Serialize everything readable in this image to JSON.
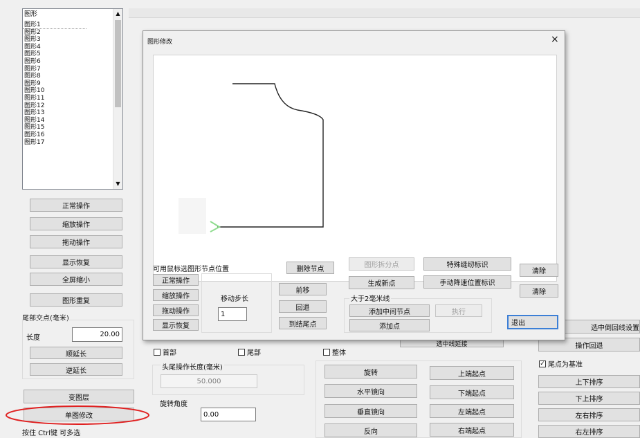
{
  "list": {
    "header": "图形",
    "items": [
      "图形1",
      "图形2",
      "图形3",
      "图形4",
      "图形5",
      "图形6",
      "图形7",
      "图形8",
      "图形9",
      "图形10",
      "图形11",
      "图形12",
      "图形13",
      "图形14",
      "图形15",
      "图形16",
      "图形17"
    ]
  },
  "left_buttons": [
    "正常操作",
    "缩放操作",
    "拖动操作",
    "显示恢复",
    "全屏缩小",
    "图形重复"
  ],
  "tail": {
    "label": "尾部交点(毫米)",
    "length_label": "长度",
    "length_value": "20.00",
    "extend": "顺延长",
    "reverse": "逆延长"
  },
  "layer_btn": "变图层",
  "single_edit": "单图修改",
  "hint": "按住 Ctrl键 可多选",
  "dialog": {
    "title": "图形修改",
    "close": "×",
    "node_label": "可用鼠标选图形节点位置",
    "ops": [
      "正常操作",
      "缩放操作",
      "拖动操作",
      "显示恢复"
    ],
    "step_label": "移动步长",
    "step_value": "1",
    "del_node": "删除节点",
    "forward": "前移",
    "back": "回退",
    "to_end": "到结尾点",
    "split": "图形拆分点",
    "new_point": "生成新点",
    "gt2": "大于2毫米线",
    "add_mid": "添加中间节点",
    "add_point": "添加点",
    "exec": "执行",
    "special": "特殊缝纫标识",
    "manual": "手动降速位置标识",
    "clear1": "清除",
    "clear2": "清除",
    "exit": "退出"
  },
  "bottom": {
    "head_cb": "首部",
    "tail_cb": "尾部",
    "whole_cb": "整体",
    "head_len_label": "头尾操作长度(毫米)",
    "head_len_value": "50.000",
    "angle_label": "旋转角度",
    "angle_value": "0.00",
    "rotate": "旋转",
    "h_mirror": "水平镜向",
    "v_mirror": "垂直镜向",
    "reverse": "反向",
    "up_start": "上端起点",
    "down_start": "下端起点",
    "left_start": "左端起点",
    "right_start": "右端起点",
    "hidden_btn": "选中线延接",
    "tail_base": "尾点为基准",
    "tail_base_mark": "✓",
    "sort": [
      "上下排序",
      "下上排序",
      "左右排序",
      "右左排序"
    ],
    "select_cb_btn": "选中倒回线设置",
    "undo": "操作回退"
  }
}
